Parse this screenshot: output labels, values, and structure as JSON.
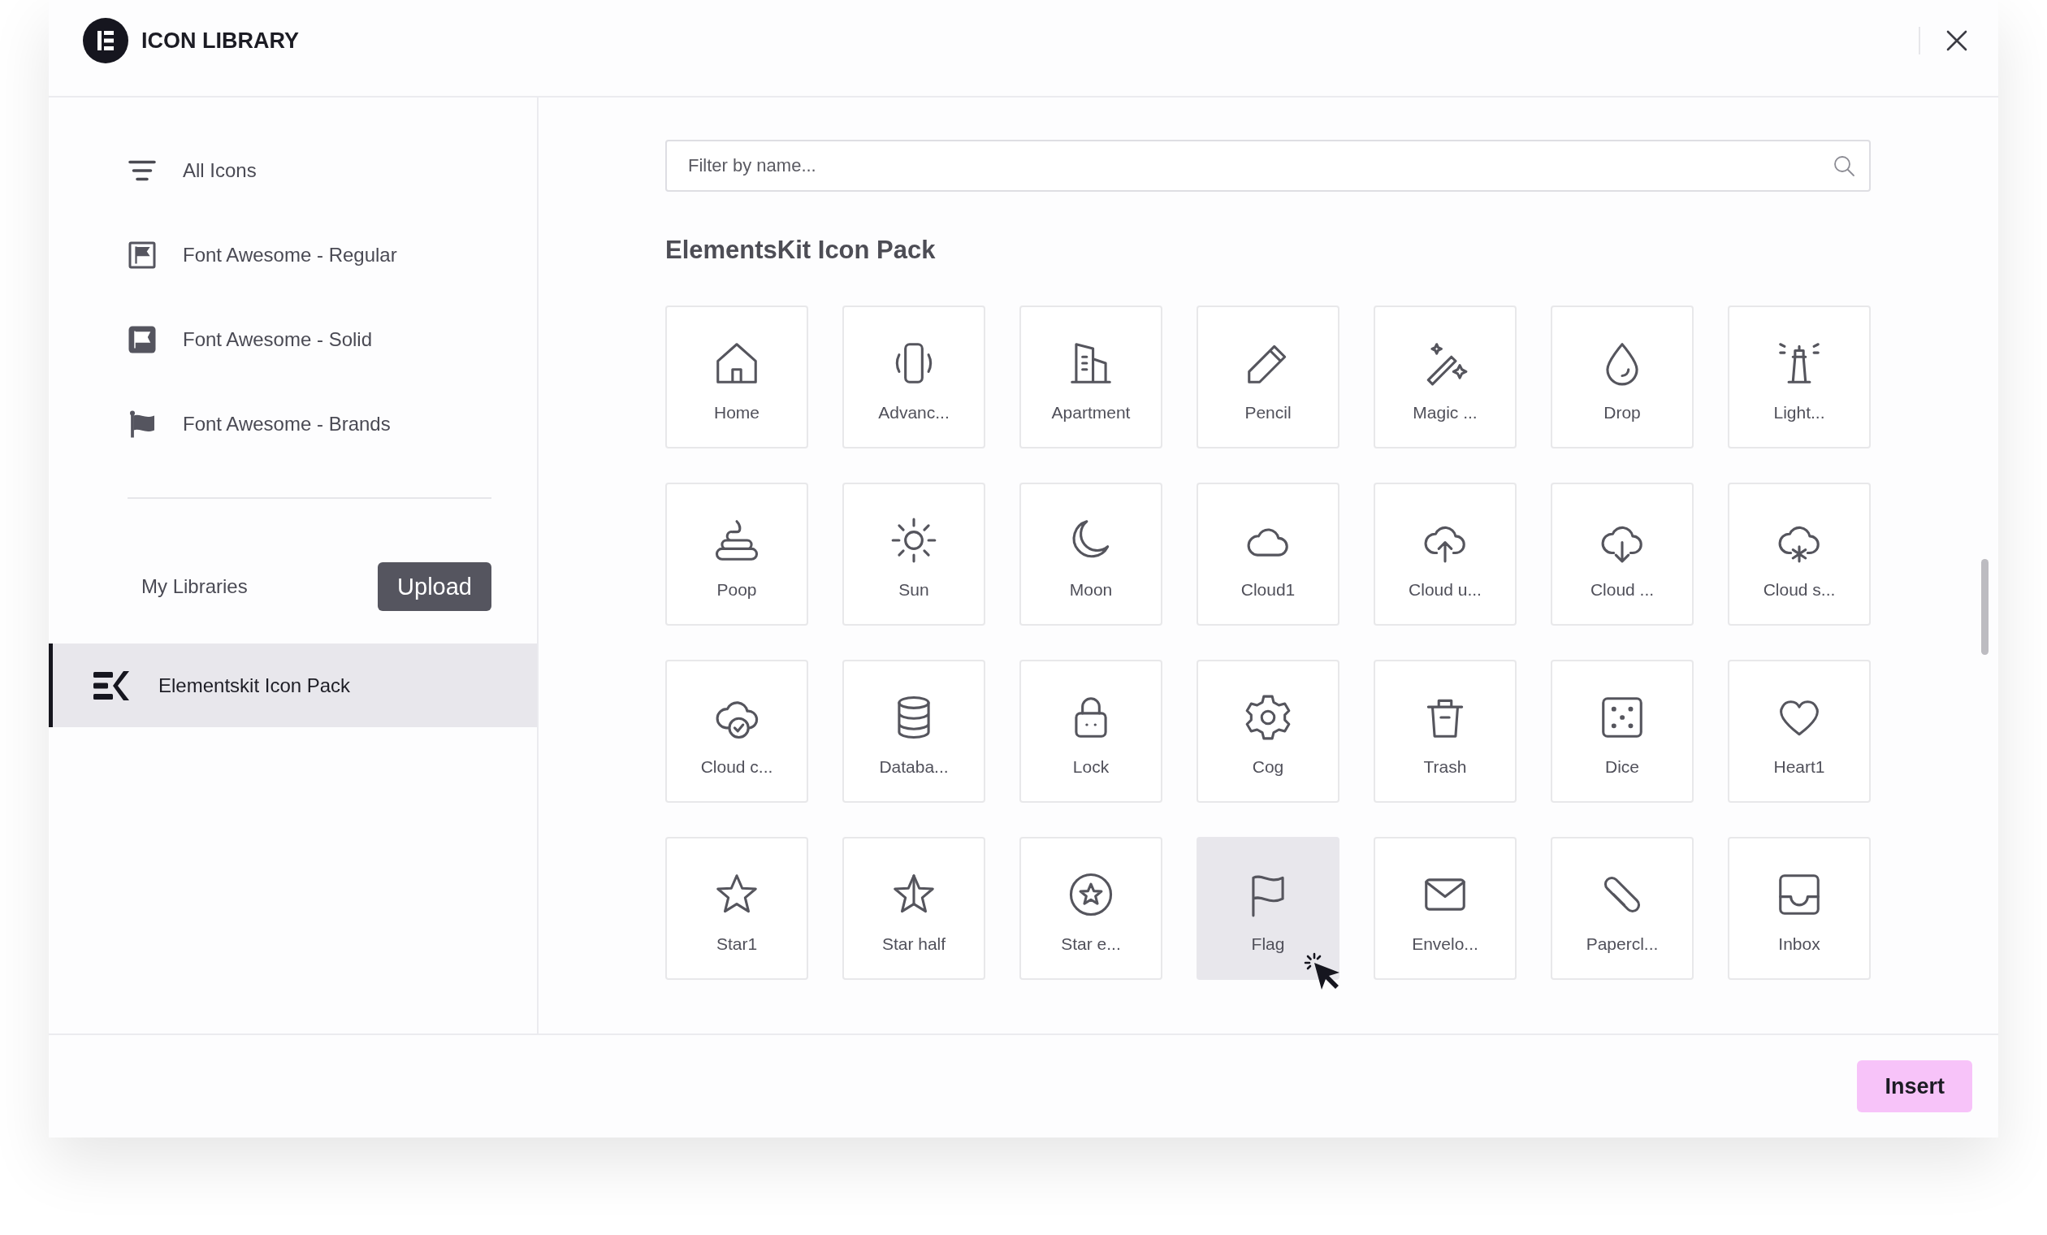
{
  "header": {
    "title": "ICON LIBRARY"
  },
  "sidebar": {
    "items": [
      {
        "label": "All Icons",
        "selected": false
      },
      {
        "label": "Font Awesome - Regular",
        "selected": false
      },
      {
        "label": "Font Awesome - Solid",
        "selected": false
      },
      {
        "label": "Font Awesome - Brands",
        "selected": false
      }
    ],
    "my_libraries": {
      "label": "My Libraries",
      "button": "Upload"
    },
    "libraries": [
      {
        "label": "Elementskit Icon Pack",
        "selected": true
      }
    ]
  },
  "search": {
    "placeholder": "Filter by name..."
  },
  "pack": {
    "title": "ElementsKit Icon Pack",
    "icons": [
      {
        "label": "Home",
        "selected": false
      },
      {
        "label": "Advanc...",
        "selected": false
      },
      {
        "label": "Apartment",
        "selected": false
      },
      {
        "label": "Pencil",
        "selected": false
      },
      {
        "label": "Magic ...",
        "selected": false
      },
      {
        "label": "Drop",
        "selected": false
      },
      {
        "label": "Light...",
        "selected": false
      },
      {
        "label": "Poop",
        "selected": false
      },
      {
        "label": "Sun",
        "selected": false
      },
      {
        "label": "Moon",
        "selected": false
      },
      {
        "label": "Cloud1",
        "selected": false
      },
      {
        "label": "Cloud u...",
        "selected": false
      },
      {
        "label": "Cloud ...",
        "selected": false
      },
      {
        "label": "Cloud s...",
        "selected": false
      },
      {
        "label": "Cloud c...",
        "selected": false
      },
      {
        "label": "Databa...",
        "selected": false
      },
      {
        "label": "Lock",
        "selected": false
      },
      {
        "label": "Cog",
        "selected": false
      },
      {
        "label": "Trash",
        "selected": false
      },
      {
        "label": "Dice",
        "selected": false
      },
      {
        "label": "Heart1",
        "selected": false
      },
      {
        "label": "Star1",
        "selected": false
      },
      {
        "label": "Star half",
        "selected": false
      },
      {
        "label": "Star e...",
        "selected": false
      },
      {
        "label": "Flag",
        "selected": true
      },
      {
        "label": "Envelo...",
        "selected": false
      },
      {
        "label": "Papercl...",
        "selected": false
      },
      {
        "label": "Inbox",
        "selected": false
      }
    ]
  },
  "footer": {
    "button": "Insert"
  }
}
